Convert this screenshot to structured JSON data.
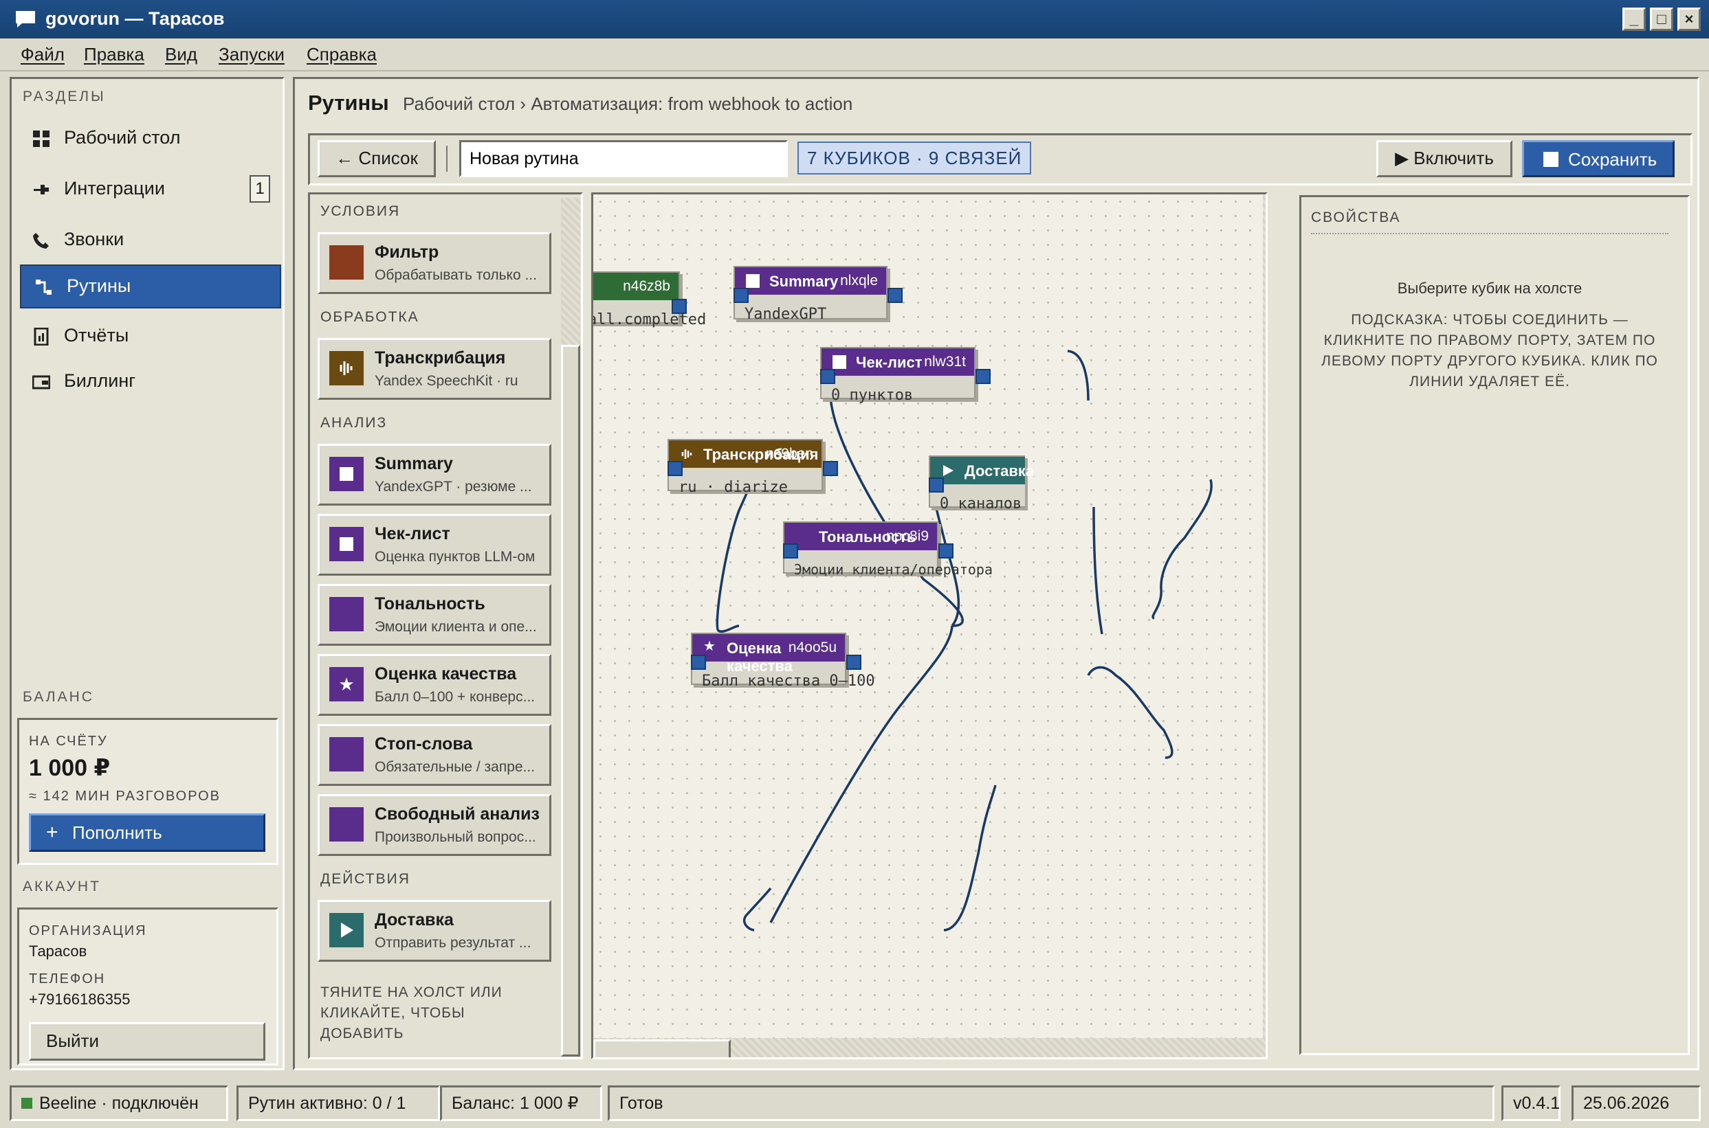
{
  "window": {
    "title": "govorun — Тарасов"
  },
  "menu": [
    "Файл",
    "Правка",
    "Вид",
    "Запуски",
    "Справка"
  ],
  "sidebar": {
    "section_title": "РАЗДЕЛЫ",
    "items": [
      {
        "label": "Рабочий стол"
      },
      {
        "label": "Интеграции",
        "badge": "1"
      },
      {
        "label": "Звонки"
      },
      {
        "label": "Рутины",
        "active": true
      },
      {
        "label": "Отчёты"
      },
      {
        "label": "Биллинг"
      }
    ],
    "balance": {
      "section_title": "БАЛАНС",
      "label": "НА СЧЁТУ",
      "amount": "1 000 ₽",
      "minutes": "≈ 142 МИН РАЗГОВОРОВ",
      "topup_label": "Пополнить"
    },
    "account": {
      "section_title": "АККАУНТ",
      "org_label": "ОРГАНИЗАЦИЯ",
      "org": "Тарасов",
      "phone_label": "ТЕЛЕФОН",
      "phone": "+79166186355",
      "logout_label": "Выйти"
    }
  },
  "header": {
    "title": "Рутины",
    "breadcrumb": "Рабочий стол › Автоматизация: from webhook to action"
  },
  "toolbar": {
    "back_label": "← Список",
    "name_value": "Новая рутина",
    "counter": "7 КУБИКОВ · 9 СВЯЗЕЙ",
    "enable_label": "Включить",
    "save_label": "Сохранить"
  },
  "palette": {
    "sections": [
      {
        "title": "УСЛОВИЯ",
        "items": [
          {
            "name": "Фильтр",
            "desc": "Обрабатывать только ...",
            "color": "#8a3b1e",
            "icon": "none"
          }
        ]
      },
      {
        "title": "ОБРАБОТКА",
        "items": [
          {
            "name": "Транскрибация",
            "desc": "Yandex SpeechKit · ru",
            "color": "#6b4a12",
            "icon": "waveform-icon"
          }
        ]
      },
      {
        "title": "АНАЛИЗ",
        "items": [
          {
            "name": "Summary",
            "desc": "YandexGPT · резюме ...",
            "color": "#5a2d8c",
            "icon": "square-icon"
          },
          {
            "name": "Чек-лист",
            "desc": "Оценка пунктов LLM-ом",
            "color": "#5a2d8c",
            "icon": "square-icon"
          },
          {
            "name": "Тональность",
            "desc": "Эмоции клиента и опе...",
            "color": "#5a2d8c",
            "icon": "none"
          },
          {
            "name": "Оценка качества",
            "desc": "Балл 0–100 + конверс...",
            "color": "#5a2d8c",
            "icon": "star-icon"
          },
          {
            "name": "Стоп-слова",
            "desc": "Обязательные / запре...",
            "color": "#5a2d8c",
            "icon": "none"
          },
          {
            "name": "Свободный анализ",
            "desc": "Произвольный вопрос...",
            "color": "#5a2d8c",
            "icon": "none"
          }
        ]
      },
      {
        "title": "ДЕЙСТВИЯ",
        "items": [
          {
            "name": "Доставка",
            "desc": "Отправить результат ...",
            "color": "#2b6b6b",
            "icon": "play-icon"
          }
        ]
      }
    ],
    "hint": "ТЯНИТЕ НА ХОЛСТ ИЛИ КЛИКАЙТЕ, ЧТОБЫ ДОБАВИТЬ"
  },
  "canvas": {
    "nodes": [
      {
        "key": "webhook",
        "title": "",
        "id": "n46z8b",
        "body": "all.completed",
        "color": "#2e6b35"
      },
      {
        "key": "summary",
        "title": "Summary",
        "id": "nlxqle",
        "body": "YandexGPT",
        "color": "#5a2d8c"
      },
      {
        "key": "checklist",
        "title": "Чек-лист",
        "id": "nlw31t",
        "body": "0 пунктов",
        "color": "#5a2d8c"
      },
      {
        "key": "transcribe",
        "title": "Транскрибация",
        "id": "ns9ben",
        "body": "ru · diarize",
        "color": "#6b4a12"
      },
      {
        "key": "delivery",
        "title": "Доставка",
        "id": "",
        "body": "0 каналов",
        "color": "#2b6b6b"
      },
      {
        "key": "tone",
        "title": "Тональность",
        "id": "npc8i9",
        "body": "Эмоции клиента/оператора",
        "color": "#5a2d8c"
      },
      {
        "key": "quality",
        "title": "Оценка качества",
        "id": "n4oo5u",
        "body": "Балл качества 0–100",
        "color": "#5a2d8c"
      }
    ]
  },
  "properties": {
    "title": "СВОЙСТВА",
    "empty": "Выберите кубик на холсте",
    "hint": "ПОДСКАЗКА: ЧТОБЫ СОЕДИНИТЬ — КЛИКНИТЕ ПО ПРАВОМУ ПОРТУ, ЗАТЕМ ПО ЛЕВОМУ ПОРТУ ДРУГОГО КУБИКА. КЛИК ПО ЛИНИИ УДАЛЯЕТ ЕЁ."
  },
  "status": {
    "connection": "Beeline · подключён",
    "routines": "Рутин активно: 0 / 1",
    "balance": "Баланс: 1 000 ₽",
    "state": "Готов",
    "version": "v0.4.1",
    "date": "25.06.2026"
  }
}
